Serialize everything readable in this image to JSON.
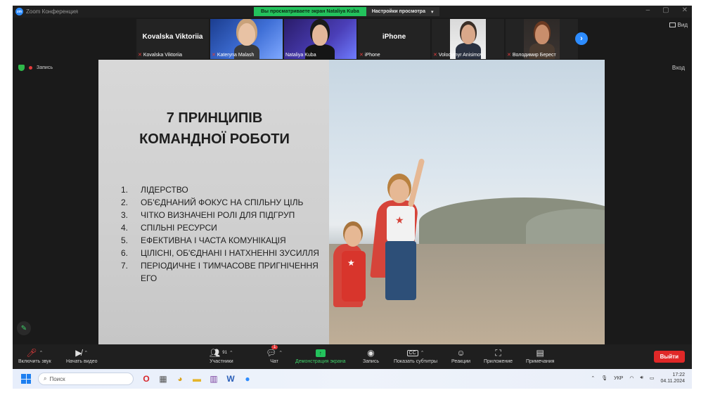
{
  "window": {
    "title": "Zoom Конференция",
    "share_notice": "Вы просматриваете экран Nataliya Kuba",
    "view_options": "Настройки просмотра",
    "view_button": "Вид",
    "exit_fullscreen": "Вход"
  },
  "recording": {
    "label": "Запись"
  },
  "gallery": {
    "tiles": [
      {
        "big_name": "Kovalska Viktoriia",
        "label": "Kovalska Viktoriia",
        "kind": "name-only"
      },
      {
        "big_name": "",
        "label": "Kateryna Malash",
        "kind": "video"
      },
      {
        "big_name": "",
        "label": "Nataliya Kuba",
        "kind": "video"
      },
      {
        "big_name": "iPhone",
        "label": "iPhone",
        "kind": "name-only"
      },
      {
        "big_name": "",
        "label": "Volodymyr Anisimov",
        "kind": "video"
      },
      {
        "big_name": "",
        "label": "Володимир Берест",
        "kind": "video"
      }
    ]
  },
  "slide": {
    "title_line1": "7 ПРИНЦИПІВ",
    "title_line2": "КОМАНДНОЇ РОБОТИ",
    "items": [
      {
        "num": "1.",
        "text": "ЛІДЕРСТВО"
      },
      {
        "num": "2.",
        "text": "ОБ'ЄДНАНИЙ ФОКУС НА СПІЛЬНУ ЦІЛЬ"
      },
      {
        "num": "3.",
        "text": "ЧІТКО ВИЗНАЧЕНІ РОЛІ ДЛЯ ПІДГРУП"
      },
      {
        "num": "4.",
        "text": "СПІЛЬНІ РЕСУРСИ"
      },
      {
        "num": "5.",
        "text": "ЕФЕКТИВНА І ЧАСТА КОМУНІКАЦІЯ"
      },
      {
        "num": "6.",
        "text": "ЦІЛІСНІ, ОБ'ЄДНАНІ І НАТХНЕННІ ЗУСИЛЛЯ"
      },
      {
        "num": "7.",
        "text": "ПЕРІОДИЧНЕ І ТИМЧАСОВЕ ПРИГНІЧЕННЯ ЕГО"
      }
    ]
  },
  "toolbar": {
    "unmute": "Включить звук",
    "start_video": "Начать видео",
    "participants": "Участники",
    "participants_count": "91",
    "chat": "Чат",
    "chat_badge": "1",
    "share_screen": "Демонстрация экрана",
    "record": "Запись",
    "captions": "Показать субтитры",
    "captions_icon": "CC",
    "reactions": "Реакции",
    "apps": "Приложение",
    "notes": "Примечания",
    "leave": "Выйти"
  },
  "taskbar": {
    "search_placeholder": "Поиск",
    "language": "УКР",
    "time": "17:22",
    "date": "04.11.2024"
  },
  "colors": {
    "zoom_blue": "#2d8cff",
    "share_green": "#23c25c",
    "leave_red": "#e02828",
    "mic_off_red": "#e33b3b"
  }
}
